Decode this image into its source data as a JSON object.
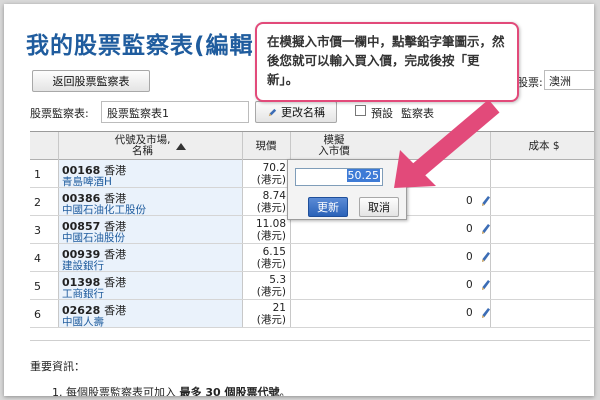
{
  "page": {
    "title": "我的股票監察表(編輯"
  },
  "toolbar": {
    "back_label": "返回股票監察表",
    "name_label": "股票監察表:",
    "name_value": "股票監察表1",
    "rename_label": "更改名稱",
    "preset_label": "預設",
    "preset_rest": "監察表",
    "market_label": "股票:",
    "market_value": "澳洲"
  },
  "table": {
    "headers": {
      "code": "代號及市場,\n名稱",
      "price": "現價",
      "sim": "模擬\n入市價",
      "cost": "成本 $"
    },
    "rows": [
      {
        "num": "1",
        "code": "00168",
        "market": "香港",
        "name": "青島啤酒H",
        "price": "70.2",
        "ccy": "(港元)",
        "sim": ""
      },
      {
        "num": "2",
        "code": "00386",
        "market": "香港",
        "name": "中國石油化工股份",
        "price": "8.74",
        "ccy": "(港元)",
        "sim": "0"
      },
      {
        "num": "3",
        "code": "00857",
        "market": "香港",
        "name": "中國石油股份",
        "price": "11.08",
        "ccy": "(港元)",
        "sim": "0"
      },
      {
        "num": "4",
        "code": "00939",
        "market": "香港",
        "name": "建設銀行",
        "price": "6.15",
        "ccy": "(港元)",
        "sim": "0"
      },
      {
        "num": "5",
        "code": "01398",
        "market": "香港",
        "name": "工商銀行",
        "price": "5.3",
        "ccy": "(港元)",
        "sim": "0"
      },
      {
        "num": "6",
        "code": "02628",
        "market": "香港",
        "name": "中國人壽",
        "price": "21",
        "ccy": "(港元)",
        "sim": "0"
      }
    ]
  },
  "popup": {
    "value": "50.25",
    "update_label": "更新",
    "cancel_label": "取消"
  },
  "tooltip": {
    "text": "在模擬入市價一欄中，點擊鉛字筆圖示，然後您就可以輸入買入價，完成後按「更新」。"
  },
  "info": {
    "title": "重要資訊：",
    "item_prefix": "1.  每個股票監察表可加入 ",
    "item_bold": "最多 30 個股票代號",
    "item_suffix": "。"
  },
  "colors": {
    "accent": "#1f5c9e",
    "callout": "#e24a7a",
    "code_bg": "#eaf2fb"
  }
}
